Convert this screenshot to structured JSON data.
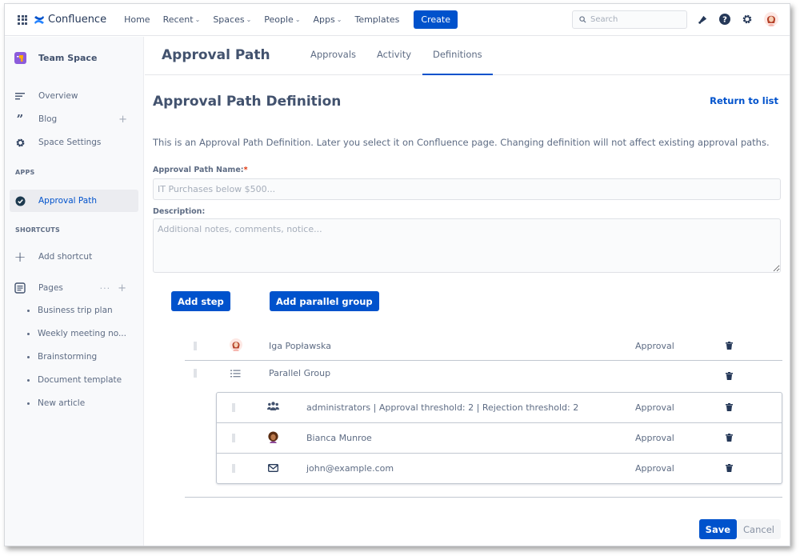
{
  "topnav": {
    "app_name": "Confluence",
    "items": [
      {
        "label": "Home",
        "has_dropdown": false
      },
      {
        "label": "Recent",
        "has_dropdown": true
      },
      {
        "label": "Spaces",
        "has_dropdown": true
      },
      {
        "label": "People",
        "has_dropdown": true
      },
      {
        "label": "Apps",
        "has_dropdown": true
      },
      {
        "label": "Templates",
        "has_dropdown": false
      }
    ],
    "create_label": "Create",
    "search_placeholder": "Search",
    "icons": [
      "notifications-icon",
      "help-icon",
      "settings-icon",
      "user-avatar"
    ]
  },
  "sidebar": {
    "space_name": "Team Space",
    "items": [
      {
        "label": "Overview",
        "icon": "overview-icon"
      },
      {
        "label": "Blog",
        "icon": "quote-icon"
      },
      {
        "label": "Space Settings",
        "icon": "gear-icon"
      }
    ],
    "apps_heading": "APPS",
    "apps": [
      {
        "label": "Approval Path",
        "icon": "check-circle-icon",
        "active": true
      }
    ],
    "shortcuts_heading": "SHORTCUTS",
    "add_shortcut_label": "Add shortcut",
    "pages_label": "Pages",
    "pages_more": "···",
    "pages": [
      "Business trip plan",
      "Weekly meeting no...",
      "Brainstorming",
      "Document template",
      "New article"
    ]
  },
  "header": {
    "title": "Approval Path",
    "tabs": [
      {
        "label": "Approvals",
        "active": false
      },
      {
        "label": "Activity",
        "active": false
      },
      {
        "label": "Definitions",
        "active": true
      }
    ]
  },
  "main": {
    "title": "Approval Path Definition",
    "return_link": "Return to list",
    "intro": "This is an Approval Path Definition. Later you select it on Confluence page. Changing definition will not affect existing approval paths.",
    "name_label": "Approval Path Name:",
    "required_mark": "*",
    "name_value": "",
    "name_placeholder": "IT Purchases below $500...",
    "description_label": "Description:",
    "description_value": "",
    "description_placeholder": "Additional notes, comments, notice...",
    "add_step_label": "Add step",
    "add_parallel_group_label": "Add parallel group",
    "steps": [
      {
        "name": "Iga Popławska",
        "type": "Approval",
        "icon": "user-avatar"
      },
      {
        "name": "Parallel Group",
        "type": "",
        "icon": "list-icon",
        "members": [
          {
            "name": "administrators | Approval threshold: 2 | Rejection threshold: 2",
            "type": "Approval",
            "icon": "group-icon"
          },
          {
            "name": "Bianca Munroe",
            "type": "Approval",
            "icon": "user-avatar"
          },
          {
            "name": "john@example.com",
            "type": "Approval",
            "icon": "mail-icon"
          }
        ]
      }
    ],
    "save_label": "Save",
    "cancel_label": "Cancel"
  },
  "colors": {
    "brand": "#0052cc",
    "text": "#42526e",
    "required": "#de350b",
    "space_logo": "#8c5cdb"
  }
}
